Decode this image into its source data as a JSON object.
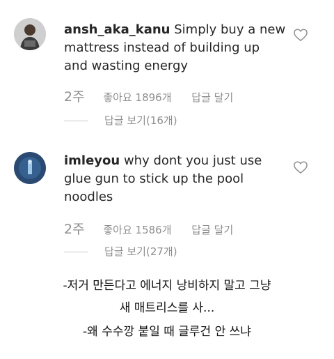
{
  "comments": [
    {
      "username": "ansh_aka_kanu",
      "text": "Simply buy a new mattress instead of building up and wasting energy",
      "time": "2주",
      "likes": "좋아요 1896개",
      "reply": "답글 달기",
      "view_replies": "답글 보기(16개)",
      "avatar_icon": "avatar-person-icon"
    },
    {
      "username": "imleyou",
      "text": "why dont you just use glue gun to stick up the pool noodles",
      "time": "2주",
      "likes": "좋아요 1586개",
      "reply": "답글 달기",
      "view_replies": "답글 보기(27개)",
      "avatar_icon": "avatar-blue-icon"
    }
  ],
  "captions": [
    "-저거 만든다고 에너지 낭비하지 말고 그냥",
    "새 매트리스를 사...",
    "-왜 수수깡 붙일 때 글루건 안 쓰냐"
  ],
  "colors": {
    "text": "#262626",
    "secondary": "#8e8e8e",
    "avatar2_bg": "#2a4a72"
  }
}
